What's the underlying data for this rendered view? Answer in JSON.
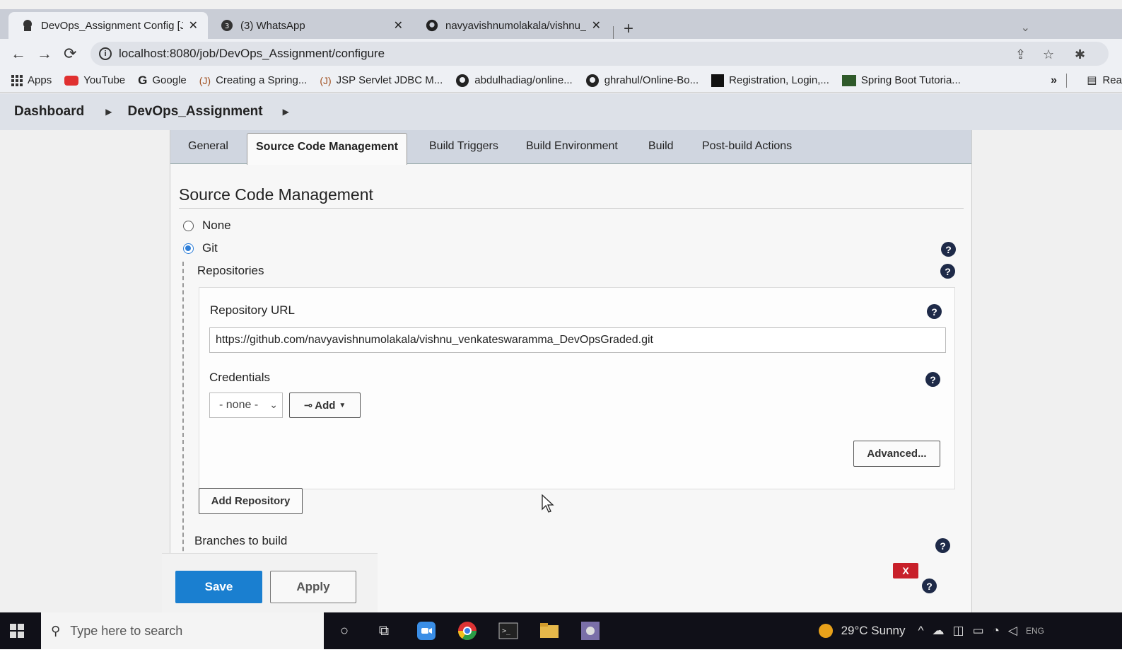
{
  "browser": {
    "tabs": [
      {
        "title": "DevOps_Assignment Config [Jenk",
        "active": true
      },
      {
        "title": "(3) WhatsApp",
        "active": false
      },
      {
        "title": "navyavishnumolakala/vishnu_ven",
        "active": false
      }
    ],
    "address": "localhost:8080/job/DevOps_Assignment/configure",
    "bookmarks": [
      {
        "label": "Apps",
        "icon": "apps-grid-icon"
      },
      {
        "label": "YouTube",
        "icon": "youtube-icon"
      },
      {
        "label": "Google",
        "icon": "google-icon"
      },
      {
        "label": "Creating a Spring...",
        "icon": "javatpoint-icon"
      },
      {
        "label": "JSP Servlet JDBC M...",
        "icon": "javatpoint-icon"
      },
      {
        "label": "abdulhadiag/online...",
        "icon": "github-icon"
      },
      {
        "label": "ghrahul/Online-Bo...",
        "icon": "github-icon"
      },
      {
        "label": "Registration, Login,...",
        "icon": "black-square-icon"
      },
      {
        "label": "Spring Boot Tutoria...",
        "icon": "green-square-icon"
      }
    ],
    "reading_list": "Rea"
  },
  "jenkins": {
    "breadcrumb": [
      "Dashboard",
      "DevOps_Assignment"
    ],
    "config_tabs": [
      "General",
      "Source Code Management",
      "Build Triggers",
      "Build Environment",
      "Build",
      "Post-build Actions"
    ],
    "active_tab": "Source Code Management",
    "section_title": "Source Code Management",
    "scm_options": [
      {
        "label": "None",
        "selected": false
      },
      {
        "label": "Git",
        "selected": true
      }
    ],
    "repositories_label": "Repositories",
    "repo_url_label": "Repository URL",
    "repo_url_value": "https://github.com/navyavishnumolakala/vishnu_venkateswaramma_DevOpsGraded.git",
    "credentials_label": "Credentials",
    "credentials_selected": "- none -",
    "add_label": "Add",
    "advanced_label": "Advanced...",
    "add_repository_label": "Add Repository",
    "branches_label": "Branches to build",
    "delete_label": "X",
    "save_label": "Save",
    "apply_label": "Apply"
  },
  "taskbar": {
    "search_placeholder": "Type here to search",
    "weather": "29°C  Sunny",
    "language": "ENG"
  },
  "colors": {
    "save_blue": "#1a7fd0",
    "help_navy": "#1e2a48",
    "delete_red": "#c8202a",
    "radio_blue": "#2f7fd8"
  }
}
